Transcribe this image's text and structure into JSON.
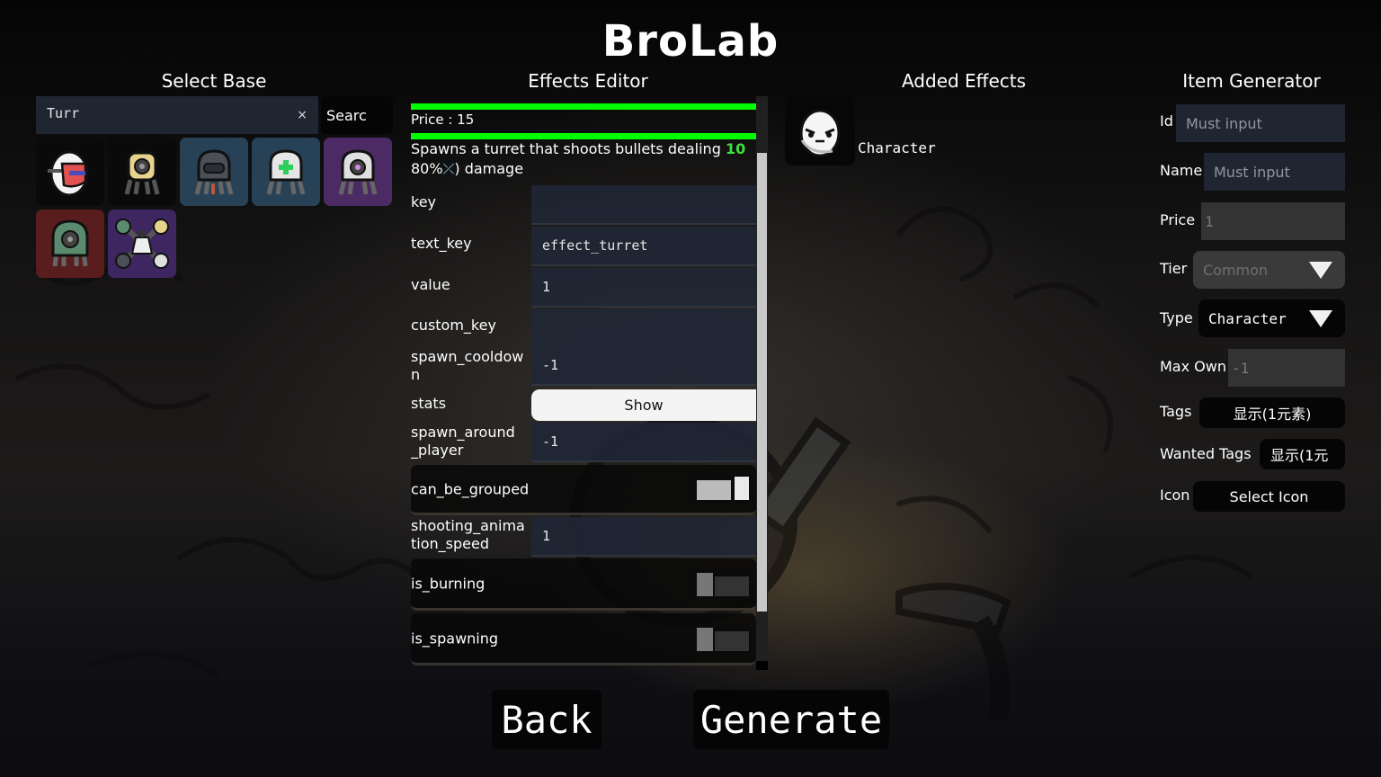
{
  "app_title": "BroLab",
  "select_base": {
    "title": "Select Base",
    "search_value": "Turr",
    "clear_icon": "×",
    "search_button": "Searc",
    "items": [
      {
        "name": "character-masked-egg",
        "bg": "#0a0a0a"
      },
      {
        "name": "turret-yellow",
        "bg": "#0a0a0a"
      },
      {
        "name": "turret-grey-visor",
        "bg": "#274257"
      },
      {
        "name": "turret-healing",
        "bg": "#274257"
      },
      {
        "name": "turret-purple-core",
        "bg": "#4c2a64"
      },
      {
        "name": "turret-green",
        "bg": "#5a1d1d"
      },
      {
        "name": "turret-cluster",
        "bg": "#3e2660"
      }
    ]
  },
  "effects_editor": {
    "title": "Effects Editor",
    "price_label": "Price : 15",
    "description": {
      "text_before": "Spawns a turret that shoots bullets dealing ",
      "number": "10",
      "text_line2_before": "80%",
      "scaling_icon": "ranged-damage-icon",
      "scaling_glyph": "⤫",
      "text_after": ") damage"
    },
    "fields": [
      {
        "label": "key",
        "value": ""
      },
      {
        "label": "text_key",
        "value": "effect_turret"
      },
      {
        "label": "value",
        "value": "1"
      },
      {
        "label": "custom_key",
        "value": ""
      },
      {
        "label": "spawn_cooldown",
        "label_l1": "spawn_cooldow",
        "label_l2": "n",
        "value": "-1"
      },
      {
        "label": "stats",
        "button": "Show"
      },
      {
        "label": "spawn_around_player",
        "label_l1": "spawn_around",
        "label_l2": "_player",
        "value": "-1"
      },
      {
        "label": "can_be_grouped",
        "toggle": true
      },
      {
        "label": "shooting_animation_speed",
        "label_l1": "shooting_anima",
        "label_l2": "tion_speed",
        "value": "1"
      },
      {
        "label": "is_burning",
        "toggle": false
      },
      {
        "label": "is_spawning",
        "toggle": false
      }
    ],
    "scroll_position": 0.1
  },
  "added_effects": {
    "title": "Added Effects",
    "items": [
      {
        "label": "Character",
        "icon": "character-egg-icon"
      }
    ]
  },
  "item_generator": {
    "title": "Item Generator",
    "id": {
      "label": "Id",
      "placeholder": "Must input"
    },
    "name": {
      "label": "Name",
      "placeholder": "Must input"
    },
    "price": {
      "label": "Price",
      "value": "1"
    },
    "tier": {
      "label": "Tier",
      "value": "Common"
    },
    "type": {
      "label": "Type",
      "value": "Character"
    },
    "max_own": {
      "label": "Max Own",
      "value": "-1"
    },
    "tags": {
      "label": "Tags",
      "button": "显示(1元素)"
    },
    "wanted_tags": {
      "label": "Wanted Tags",
      "button": "显示(1元"
    },
    "icon": {
      "label": "Icon",
      "button": "Select Icon"
    }
  },
  "footer": {
    "back": "Back",
    "generate": "Generate"
  },
  "colors": {
    "accent_green": "#00ff00",
    "input_bg": "#1f2632",
    "number_green": "#3de03d"
  }
}
